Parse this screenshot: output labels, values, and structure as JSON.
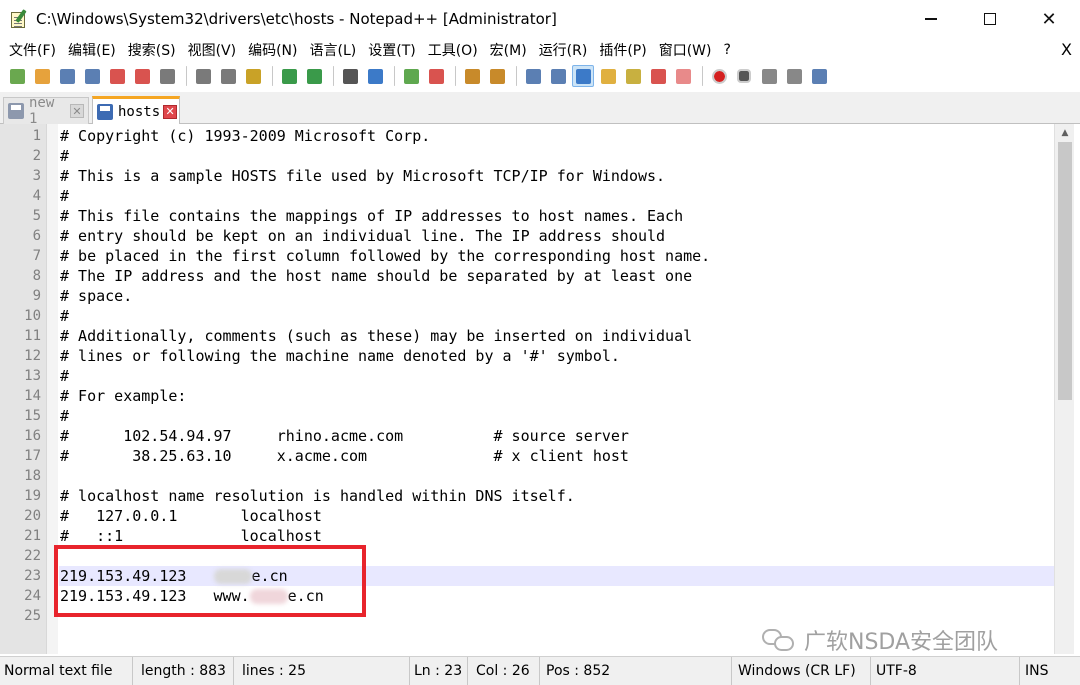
{
  "window": {
    "title": "C:\\Windows\\System32\\drivers\\etc\\hosts - Notepad++ [Administrator]",
    "min_label": "",
    "max_label": "",
    "close_label": "✕"
  },
  "menu": {
    "items": [
      "文件(F)",
      "编辑(E)",
      "搜索(S)",
      "视图(V)",
      "编码(N)",
      "语言(L)",
      "设置(T)",
      "工具(O)",
      "宏(M)",
      "运行(R)",
      "插件(P)",
      "窗口(W)",
      "?"
    ],
    "close_doc": "X"
  },
  "toolbar": {
    "icons": [
      "new-file-icon",
      "open-file-icon",
      "save-icon",
      "save-all-icon",
      "close-icon",
      "close-all-icon",
      "print-icon",
      "cut-icon",
      "copy-icon",
      "paste-icon",
      "undo-icon",
      "redo-icon",
      "find-icon",
      "replace-icon",
      "zoom-in-icon",
      "zoom-out-icon",
      "sync-vertical-icon",
      "sync-horizontal-icon",
      "word-wrap-icon",
      "show-all-chars-icon",
      "indent-guide-icon",
      "document-map-icon",
      "function-list-icon",
      "folder-workspace-icon",
      "monitoring-icon",
      "record-macro-icon",
      "stop-record-icon",
      "playback-macro-icon",
      "run-macro-multiple-icon",
      "save-macro-icon"
    ]
  },
  "tabs": [
    {
      "label": "new 1",
      "active": false
    },
    {
      "label": "hosts",
      "active": true
    }
  ],
  "editor": {
    "lines": [
      "# Copyright (c) 1993-2009 Microsoft Corp.",
      "#",
      "# This is a sample HOSTS file used by Microsoft TCP/IP for Windows.",
      "#",
      "# This file contains the mappings of IP addresses to host names. Each",
      "# entry should be kept on an individual line. The IP address should",
      "# be placed in the first column followed by the corresponding host name.",
      "# The IP address and the host name should be separated by at least one",
      "# space.",
      "#",
      "# Additionally, comments (such as these) may be inserted on individual",
      "# lines or following the machine name denoted by a '#' symbol.",
      "#",
      "# For example:",
      "#",
      "#      102.54.94.97     rhino.acme.com          # source server",
      "#       38.25.63.10     x.acme.com              # x client host",
      "",
      "# localhost name resolution is handled within DNS itself.",
      "#   127.0.0.1       localhost",
      "#   ::1             localhost",
      "",
      "",
      "",
      ""
    ],
    "line23": {
      "ip": "219.153.49.123",
      "host_prefix": "",
      "host_suffix": "e.cn"
    },
    "line24": {
      "ip": "219.153.49.123",
      "host_prefix": "www.",
      "host_suffix": "e.cn"
    },
    "current_line": 23
  },
  "watermark": {
    "text": "广软NSDA安全团队"
  },
  "status": {
    "file_type": "Normal text file",
    "length": "length : 883",
    "lines": "lines : 25",
    "ln": "Ln : 23",
    "col": "Col : 26",
    "pos": "Pos : 852",
    "eol": "Windows (CR LF)",
    "encoding": "UTF-8",
    "mode": "INS"
  },
  "colors": {
    "highlight_box": "#e8242c",
    "gutter": "#e4e4e4",
    "current_line": "#e8e8ff",
    "active_tab_accent": "#f5a623"
  }
}
